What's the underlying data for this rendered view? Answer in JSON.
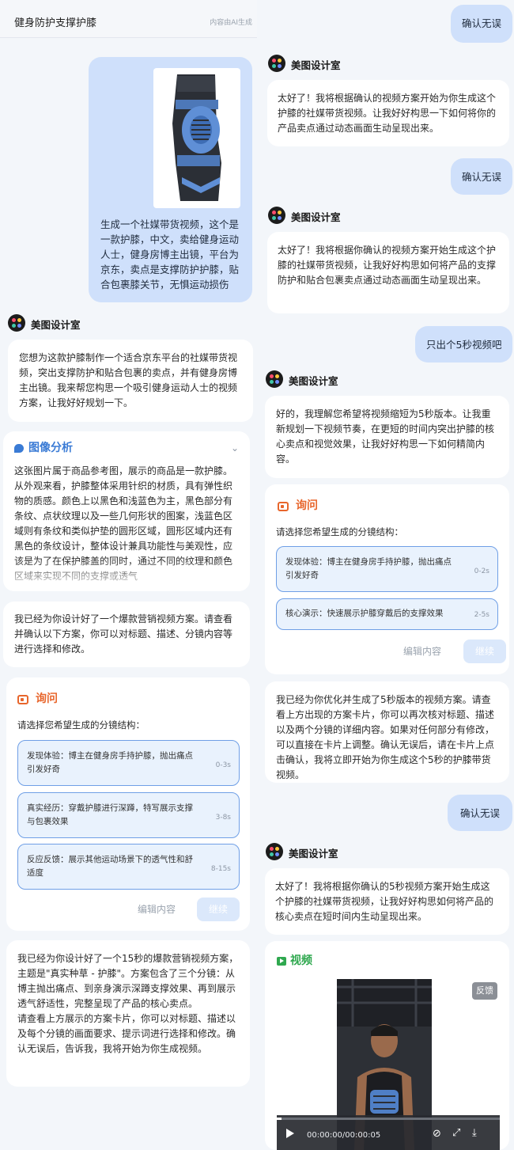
{
  "header": {
    "title": "健身防护支撑护膝",
    "ai_note": "内容由AI生成"
  },
  "bot_name": "美图设计室",
  "left": {
    "user_prompt": "生成一个社媒带货视频，这个是一款护膝，中文，卖给健身运动人士，健身房博主出镜，平台为京东，卖点是支撑防护护膝，贴合包裹膝关节，无惧运动损伤",
    "intro": "您想为这款护膝制作一个适合京东平台的社媒带货视频，突出支撑防护和贴合包裹的卖点，并有健身房博主出镜。我来帮您构思一个吸引健身运动人士的视频方案，让我好好规划一下。",
    "analysis": {
      "title": "图像分析",
      "text": "这张图片属于商品参考图，展示的商品是一款护膝。从外观来看，护膝整体采用针织的材质，具有弹性织物的质感。颜色上以黑色和浅蓝色为主，黑色部分有条纹、点状纹理以及一些几何形状的图案，浅蓝色区域则有条纹和类似护垫的圆形区域，圆形区域内还有黑色的条纹设计，整体设计兼具功能性与美观性，应该是为了在保护膝盖的同时，通过不同的纹理和颜色区域来实现不同的支撑或透气"
    },
    "designed": "我已经为你设计好了一个爆款营销视频方案。请查看并确认以下方案，你可以对标题、描述、分镜内容等进行选择和修改。",
    "inquiry": {
      "title": "询问",
      "prompt": "请选择您希望生成的分镜结构：",
      "options": [
        {
          "text": "发现体验：博主在健身房手持护膝，抛出痛点引发好奇",
          "dur": "0-3s"
        },
        {
          "text": "真实经历：穿戴护膝进行深蹲，特写展示支撑与包裹效果",
          "dur": "3-8s"
        },
        {
          "text": "反应反馈：展示其他运动场景下的透气性和舒适度",
          "dur": "8-15s"
        }
      ],
      "edit": "编辑内容",
      "continue": "继续"
    },
    "summary1": "我已经为你设计好了一个15秒的爆款营销视频方案，主题是\"真实种草 - 护膝\"。方案包含了三个分镜：从博主抛出痛点、到亲身演示深蹲支撑效果、再到展示透气舒适性，完整呈现了产品的核心卖点。",
    "summary2": "请查看上方展示的方案卡片，你可以对标题、描述以及每个分镜的画面要求、提示词进行选择和修改。确认无误后，告诉我，我将开始为你生成视频。"
  },
  "right": {
    "confirm1": "确认无误",
    "reply1": "太好了！我将根据确认的视频方案开始为你生成这个护膝的社媒带货视频。让我好好构思一下如何将你的产品卖点通过动态画面生动呈现出来。",
    "confirm2": "确认无误",
    "reply2": "太好了！我将根据你确认的视频方案开始生成这个护膝的社媒带货视频，让我好好构思如何将产品的支撑防护和贴合包裹卖点通过动态画面生动呈现出来。",
    "user5s": "只出个5秒视频吧",
    "reply3": "好的，我理解您希望将视频缩短为5秒版本。让我重新规划一下视频节奏，在更短的时间内突出护膝的核心卖点和视觉效果，让我好好构思一下如何精简内容。",
    "inquiry": {
      "title": "询问",
      "prompt": "请选择您希望生成的分镜结构：",
      "options": [
        {
          "text": "发现体验：博主在健身房手持护膝，抛出痛点引发好奇",
          "dur": "0-2s"
        },
        {
          "text": "核心演示：快速展示护膝穿戴后的支撑效果",
          "dur": "2-5s"
        }
      ],
      "edit": "编辑内容",
      "continue": "继续"
    },
    "optimized": "我已经为你优化并生成了5秒版本的视频方案。请查看上方出现的方案卡片，你可以再次核对标题、描述以及两个分镜的详细内容。如果对任何部分有修改，可以直接在卡片上调整。确认无误后，请在卡片上点击确认，我将立即开始为你生成这个5秒的护膝带货视频。",
    "confirm3": "确认无误",
    "reply4": "太好了！我将根据你确认的5秒视频方案开始生成这个护膝的社媒带货视频，让我好好构思如何将产品的核心卖点在短时间内生动呈现出来。",
    "video": {
      "title": "视频",
      "feedback": "反馈",
      "time": "00:00:00/00:00:05",
      "progress": 0.02
    }
  },
  "colors": {
    "accent_orange": "#e8662c",
    "accent_blue": "#3a7bd5",
    "video_green": "#2fa84f",
    "user_bubble": "#cfe0fb"
  }
}
